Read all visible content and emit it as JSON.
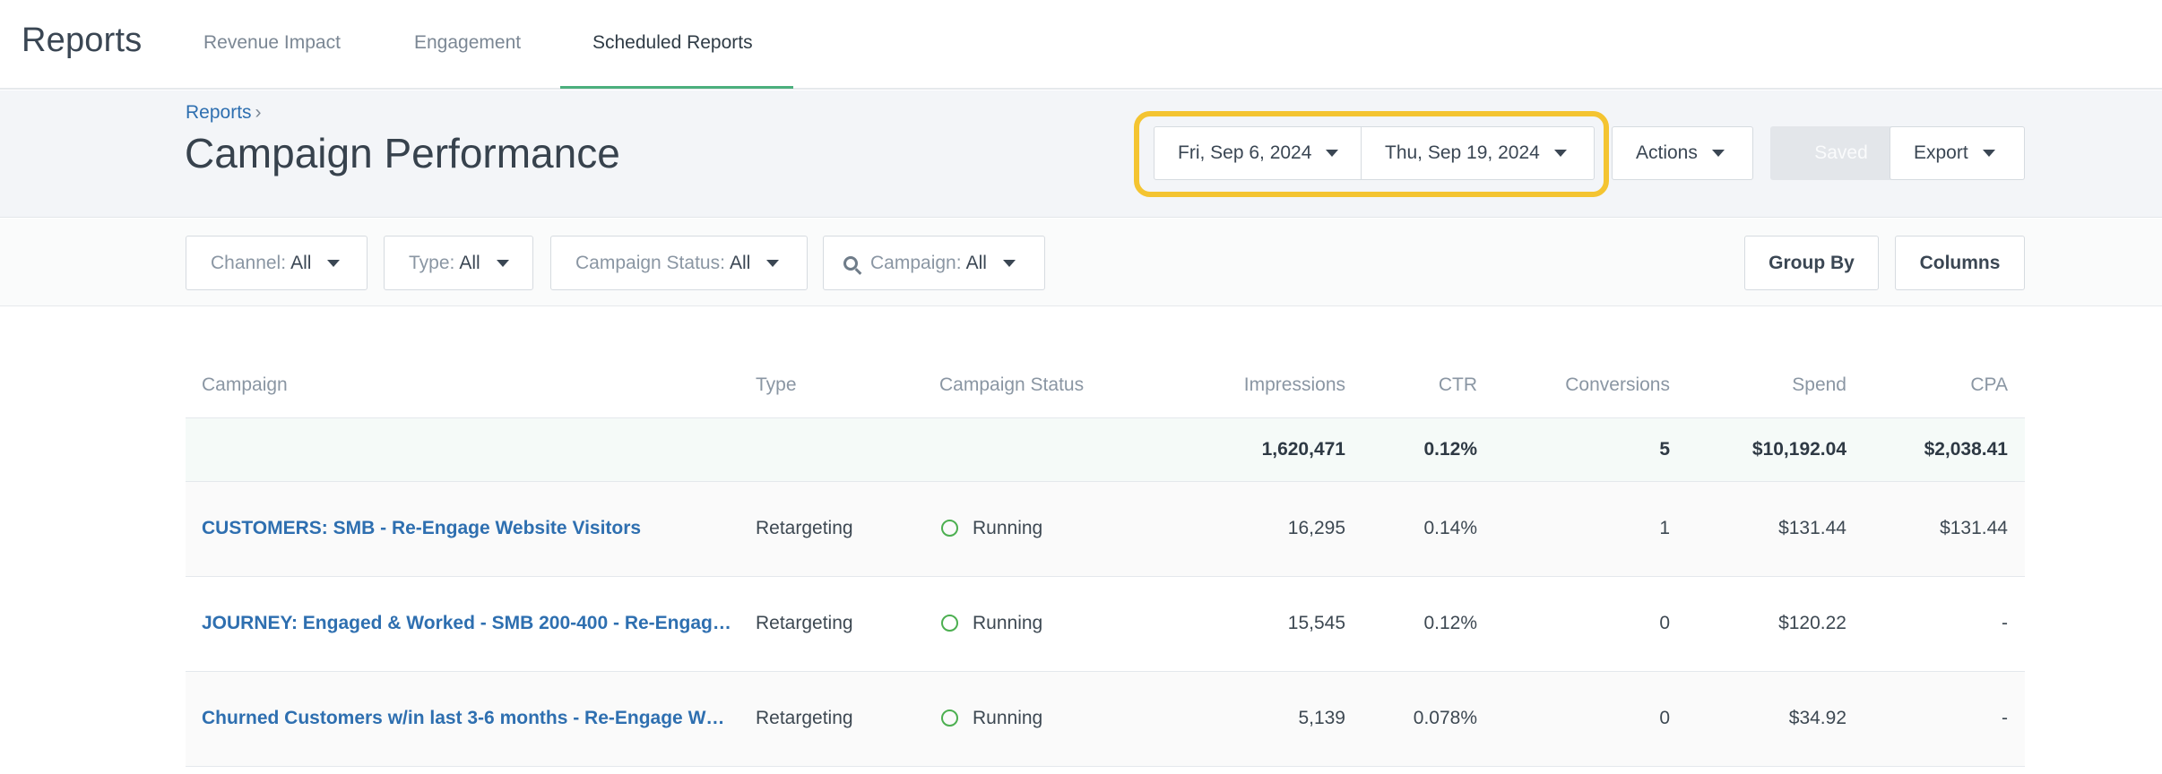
{
  "app": {
    "title": "Reports"
  },
  "tabs": [
    {
      "label": "Revenue Impact"
    },
    {
      "label": "Engagement"
    },
    {
      "label": "Scheduled Reports",
      "active": true
    }
  ],
  "breadcrumb": {
    "parent": "Reports",
    "separator": "›"
  },
  "page": {
    "title": "Campaign Performance"
  },
  "date_range": {
    "start": "Fri, Sep 6, 2024",
    "end": "Thu, Sep 19, 2024"
  },
  "toolbar": {
    "actions_label": "Actions",
    "saved_label": "Saved",
    "export_label": "Export"
  },
  "filters": [
    {
      "label": "Channel:",
      "value": "All"
    },
    {
      "label": "Type:",
      "value": "All"
    },
    {
      "label": "Campaign Status:",
      "value": "All"
    },
    {
      "label": "Campaign:",
      "value": "All",
      "icon": "search-icon"
    }
  ],
  "table_actions": {
    "group_by_label": "Group By",
    "columns_label": "Columns"
  },
  "table": {
    "columns": [
      "Campaign",
      "Type",
      "Campaign Status",
      "Impressions",
      "CTR",
      "Conversions",
      "Spend",
      "CPA"
    ],
    "totals": {
      "impressions": "1,620,471",
      "ctr": "0.12%",
      "conversions": "5",
      "spend": "$10,192.04",
      "cpa": "$2,038.41"
    },
    "rows": [
      {
        "campaign": "CUSTOMERS: SMB - Re-Engage Website Visitors",
        "type": "Retargeting",
        "status": "Running",
        "impressions": "16,295",
        "ctr": "0.14%",
        "conversions": "1",
        "spend": "$131.44",
        "cpa": "$131.44"
      },
      {
        "campaign": "JOURNEY: Engaged & Worked - SMB 200-400 - Re-Engage…",
        "type": "Retargeting",
        "status": "Running",
        "impressions": "15,545",
        "ctr": "0.12%",
        "conversions": "0",
        "spend": "$120.22",
        "cpa": "-"
      },
      {
        "campaign": "Churned Customers w/in last 3-6 months - Re-Engage W…",
        "type": "Retargeting",
        "status": "Running",
        "impressions": "5,139",
        "ctr": "0.078%",
        "conversions": "0",
        "spend": "$34.92",
        "cpa": "-"
      }
    ]
  },
  "colors": {
    "accent_green": "#4caf7d",
    "highlight": "#f4c431",
    "link": "#2e6fb0",
    "status_running": "#4caf50"
  }
}
